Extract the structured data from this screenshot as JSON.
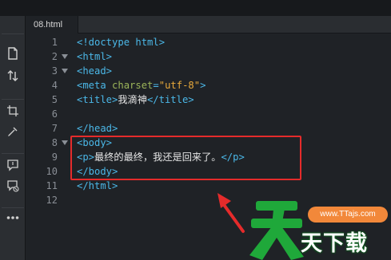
{
  "tab": {
    "filename": "08.html"
  },
  "toolbar": {
    "tools": [
      "new-file-icon",
      "sort-icon",
      "crop-icon",
      "eyedropper-icon",
      "comment-icon",
      "comment-delete-icon",
      "more-icon"
    ]
  },
  "editor": {
    "line_numbers": [
      "1",
      "2",
      "3",
      "4",
      "5",
      "6",
      "7",
      "8",
      "9",
      "10",
      "11",
      "12"
    ],
    "fold_lines": [
      2,
      3,
      8
    ],
    "lines": [
      [
        [
          "tag",
          "<!doctype html>"
        ]
      ],
      [
        [
          "tag",
          "<html>"
        ]
      ],
      [
        [
          "tag",
          "<head>"
        ]
      ],
      [
        [
          "tag",
          "<meta "
        ],
        [
          "attr",
          "charset"
        ],
        [
          "tag",
          "="
        ],
        [
          "str",
          "\"utf-8\""
        ],
        [
          "tag",
          ">"
        ]
      ],
      [
        [
          "tag",
          "<title>"
        ],
        [
          "txt",
          "我滴神"
        ],
        [
          "tag",
          "</title>"
        ]
      ],
      [],
      [
        [
          "tag",
          "</head>"
        ]
      ],
      [
        [
          "tag",
          "<body>"
        ]
      ],
      [
        [
          "tag",
          "<p>"
        ],
        [
          "txt",
          "最终的最终，我还是回来了。"
        ],
        [
          "tag",
          "</p>"
        ]
      ],
      [
        [
          "tag",
          "</body>"
        ]
      ],
      [
        [
          "tag",
          "</html>"
        ]
      ],
      []
    ]
  },
  "colors": {
    "tag": "#4bb8e8",
    "attr": "#9cb55a",
    "string": "#e8a93b",
    "highlight_box": "#e52b2b",
    "arrow": "#e52b2b",
    "watermark_green": "#1fa83a",
    "watermark_orange": "#f2883a"
  },
  "watermark": {
    "url": "www.TTajs.com",
    "text": "天下载",
    "big_char": "天"
  }
}
